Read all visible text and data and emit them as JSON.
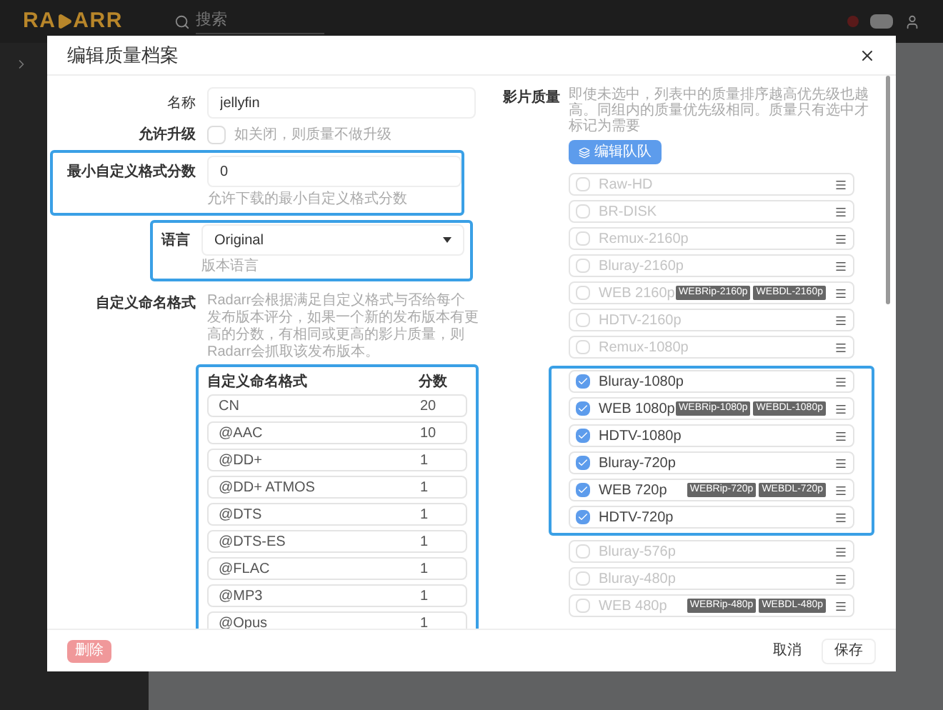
{
  "header": {
    "logo_left": "RA",
    "logo_right": "ARR",
    "search": {
      "placeholder": "搜索"
    }
  },
  "modal": {
    "title": "编辑质量档案",
    "left": {
      "name": {
        "label": "名称",
        "value": "jellyfin"
      },
      "upgrade": {
        "label": "允许升级",
        "checked": false,
        "help": "如关闭，则质量不做升级"
      },
      "min_score": {
        "label": "最小自定义格式分数",
        "value": "0",
        "help": "允许下载的最小自定义格式分数",
        "highlighted": true
      },
      "language": {
        "label": "语言",
        "value": "Original",
        "help": "版本语言",
        "highlighted": true
      },
      "formats": {
        "label": "自定义命名格式",
        "help": "Radarr会根据满足自定义格式与否给每个发布版本评分，如果一个新的发布版本有更高的分数，有相同或更高的影片质量，则Radarr会抓取该发布版本。",
        "highlighted": true,
        "columns": [
          "自定义命名格式",
          "分数"
        ],
        "rows": [
          {
            "name": "CN",
            "score": "20"
          },
          {
            "name": "@AAC",
            "score": "10"
          },
          {
            "name": "@DD+",
            "score": "1"
          },
          {
            "name": "@DD+ ATMOS",
            "score": "1"
          },
          {
            "name": "@DTS",
            "score": "1"
          },
          {
            "name": "@DTS-ES",
            "score": "1"
          },
          {
            "name": "@FLAC",
            "score": "1"
          },
          {
            "name": "@MP3",
            "score": "1"
          },
          {
            "name": "@Opus",
            "score": "1"
          }
        ]
      }
    },
    "right": {
      "label": "影片质量",
      "help": "即使未选中，列表中的质量排序越高优先级也越高。同组内的质量优先级相同。质量只有选中才标记为需要",
      "edit_groups": "编辑队队",
      "groups": [
        {
          "highlighted": false,
          "items": [
            {
              "name": "Raw-HD",
              "checked": false
            },
            {
              "name": "BR-DISK",
              "checked": false
            },
            {
              "name": "Remux-2160p",
              "checked": false
            },
            {
              "name": "Bluray-2160p",
              "checked": false
            },
            {
              "name": "WEB 2160p",
              "checked": false,
              "tags": [
                "WEBRip-2160p",
                "WEBDL-2160p"
              ]
            },
            {
              "name": "HDTV-2160p",
              "checked": false
            },
            {
              "name": "Remux-1080p",
              "checked": false
            }
          ]
        },
        {
          "highlighted": true,
          "items": [
            {
              "name": "Bluray-1080p",
              "checked": true
            },
            {
              "name": "WEB 1080p",
              "checked": true,
              "tags": [
                "WEBRip-1080p",
                "WEBDL-1080p"
              ]
            },
            {
              "name": "HDTV-1080p",
              "checked": true
            },
            {
              "name": "Bluray-720p",
              "checked": true
            },
            {
              "name": "WEB 720p",
              "checked": true,
              "tags": [
                "WEBRip-720p",
                "WEBDL-720p"
              ]
            },
            {
              "name": "HDTV-720p",
              "checked": true
            }
          ]
        },
        {
          "highlighted": false,
          "items": [
            {
              "name": "Bluray-576p",
              "checked": false
            },
            {
              "name": "Bluray-480p",
              "checked": false
            },
            {
              "name": "WEB 480p",
              "checked": false,
              "tags": [
                "WEBRip-480p",
                "WEBDL-480p"
              ]
            }
          ]
        }
      ]
    },
    "footer": {
      "delete": "删除",
      "cancel": "取消",
      "save": "保存"
    }
  }
}
